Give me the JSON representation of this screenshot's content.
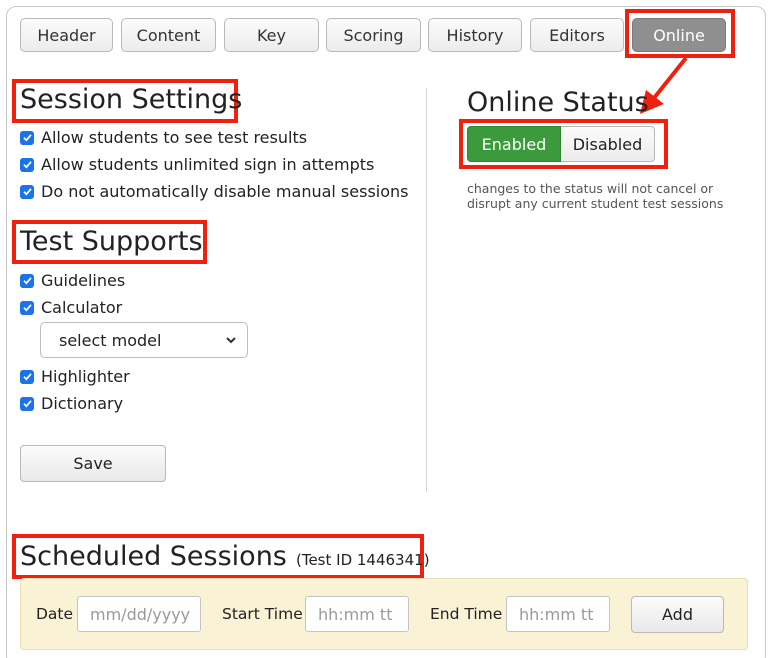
{
  "tabs": [
    {
      "label": "Header"
    },
    {
      "label": "Content"
    },
    {
      "label": "Key"
    },
    {
      "label": "Scoring"
    },
    {
      "label": "History"
    },
    {
      "label": "Editors"
    },
    {
      "label": "Online",
      "active": true
    }
  ],
  "session_settings": {
    "title": "Session Settings",
    "options": [
      {
        "label": "Allow students to see test results",
        "checked": true
      },
      {
        "label": "Allow students unlimited sign in attempts",
        "checked": true
      },
      {
        "label": "Do not automatically disable manual sessions",
        "checked": true
      }
    ]
  },
  "test_supports": {
    "title": "Test Supports",
    "guidelines": {
      "label": "Guidelines",
      "checked": true
    },
    "calculator": {
      "label": "Calculator",
      "checked": true
    },
    "calculator_model": {
      "selected": "select model"
    },
    "highlighter": {
      "label": "Highlighter",
      "checked": true
    },
    "dictionary": {
      "label": "Dictionary",
      "checked": true
    },
    "save_label": "Save"
  },
  "online_status": {
    "title": "Online Status",
    "enabled_label": "Enabled",
    "disabled_label": "Disabled",
    "current": "Enabled",
    "note": "changes to the status will not cancel or disrupt any current student test sessions"
  },
  "scheduled_sessions": {
    "title": "Scheduled Sessions",
    "test_id": "(Test ID 1446341)",
    "date_label": "Date",
    "date_placeholder": "mm/dd/yyyy",
    "start_label": "Start Time",
    "start_placeholder": "hh:mm tt",
    "end_label": "End Time",
    "end_placeholder": "hh:mm tt",
    "add_label": "Add"
  },
  "colors": {
    "highlight": "#f0200f",
    "enabled": "#3b9a3b",
    "checkbox": "#1a73e8",
    "schedule_bar": "#f9f2d4"
  }
}
